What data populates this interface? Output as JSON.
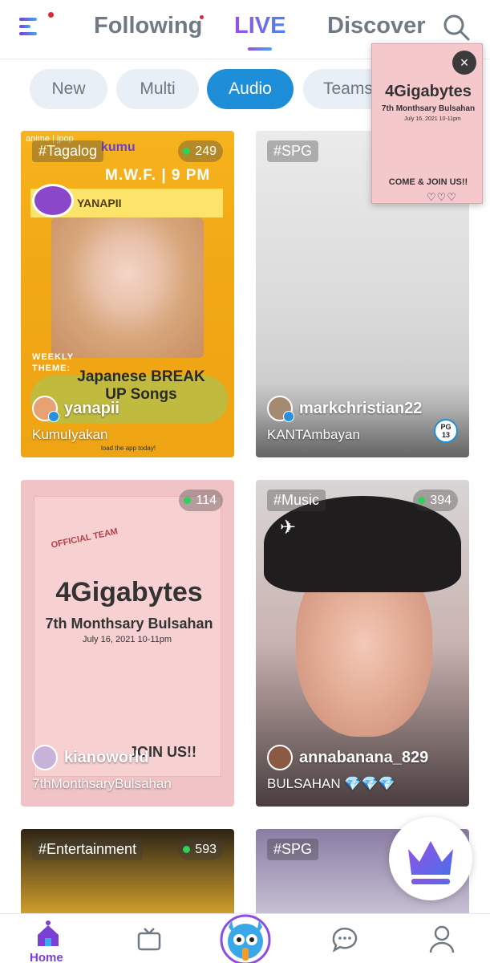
{
  "header": {
    "tabs": [
      {
        "label": "Following"
      },
      {
        "label": "LIVE"
      },
      {
        "label": "Discover"
      }
    ]
  },
  "filters": [
    {
      "label": "New"
    },
    {
      "label": "Multi"
    },
    {
      "label": "Audio"
    },
    {
      "label": "Teams"
    }
  ],
  "cards": [
    {
      "tag": "#Tagalog",
      "viewers": "249",
      "username": "yanapii",
      "title": "KumuIyakan",
      "poster": {
        "sub": "anime | jpop",
        "brand": "kumu",
        "schedule": "M.W.F. | 9 PM",
        "host": "YANAPII",
        "weekly": "WEEKLY THEME:",
        "theme": "Japanese BREAK UP Songs",
        "download": "load the app today!"
      }
    },
    {
      "tag": "#SPG",
      "username": "markchristian22",
      "title": "KANTAmbayan",
      "rating_top": "PG",
      "rating_bottom": "13"
    },
    {
      "viewers": "114",
      "username": "kianoworld",
      "title": "7thMonthsaryBulsahan",
      "poster": {
        "official": "OFFICIAL TEAM",
        "title": "4Gigabytes",
        "sub": "7th Monthsary Bulsahan",
        "date": "July 16, 2021 10-11pm",
        "cta": "JOIN US!!"
      }
    },
    {
      "tag": "#Music",
      "viewers": "394",
      "username": "annabanana_829",
      "title": "BULSAHAN 💎💎💎"
    },
    {
      "tag": "#Entertainment",
      "viewers": "593"
    },
    {
      "tag": "#SPG"
    }
  ],
  "mini_player": {
    "title": "4Gigabytes",
    "sub": "7th Monthsary Bulsahan",
    "date": "July 16, 2021 10-11pm",
    "cta": "COME & JOIN US!!",
    "hearts": "♡♡♡",
    "close": "×"
  },
  "bottom_nav": {
    "home_label": "Home"
  },
  "colors": {
    "accent_purple": "#8c4de6",
    "accent_blue": "#1e8ed9",
    "live_dot": "#2fd158",
    "notif_dot": "#e0263a"
  }
}
